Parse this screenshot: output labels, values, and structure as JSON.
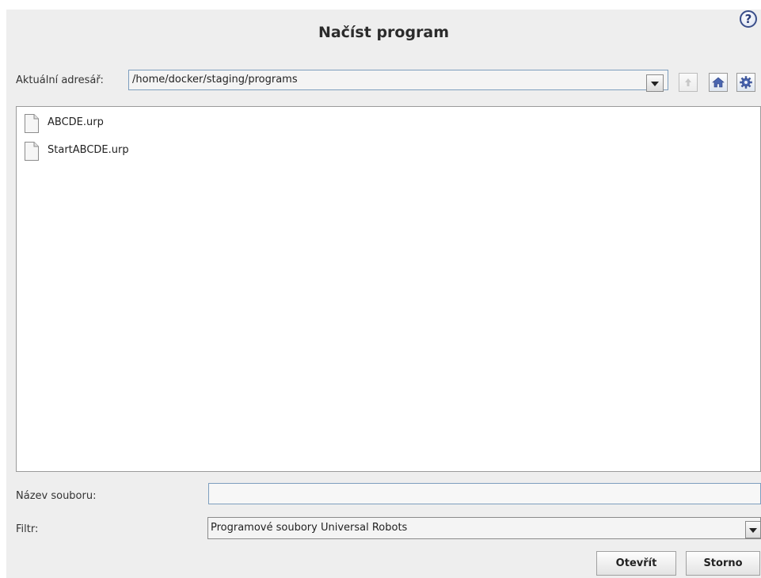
{
  "dialog": {
    "title": "Načíst program",
    "help_glyph": "?"
  },
  "directory": {
    "label": "Aktuální adresář:",
    "value": "/home/docker/staging/programs"
  },
  "toolbar": {
    "icons": [
      "arrow-up-icon",
      "home-icon",
      "gear-icon"
    ]
  },
  "files": [
    {
      "name": "ABCDE.urp",
      "icon": "file-icon"
    },
    {
      "name": "StartABCDE.urp",
      "icon": "file-icon"
    }
  ],
  "filename": {
    "label": "Název souboru:",
    "value": ""
  },
  "filter": {
    "label": "Filtr:",
    "value": "Programové soubory Universal Robots"
  },
  "buttons": {
    "open": "Otevřít",
    "cancel": "Storno"
  }
}
